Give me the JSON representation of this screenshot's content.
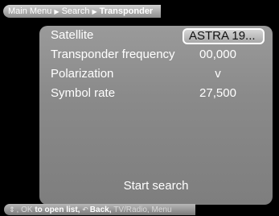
{
  "breadcrumb": {
    "items": [
      "Main Menu",
      "Search",
      "Transponder"
    ],
    "separator_icon": "triangle-right"
  },
  "settings": {
    "satellite": {
      "label": "Satellite",
      "value": "ASTRA 19..."
    },
    "frequency": {
      "label": "Transponder frequency",
      "value": "00,000"
    },
    "polarization": {
      "label": "Polarization",
      "value": "v"
    },
    "symbol_rate": {
      "label": "Symbol rate",
      "value": "27,500"
    }
  },
  "action": {
    "start_search_label": "Start search"
  },
  "hints": {
    "nav_icon": "up-down-arrows",
    "ok_label": "OK",
    "open_list_label": "to open list,",
    "back_icon": "back-arrow",
    "back_label": "Back,",
    "tvradio_label": "TV/Radio,",
    "menu_label": "Menu"
  },
  "colors": {
    "panel": "#8a8a8a",
    "background": "#000000",
    "text": "#ffffff"
  }
}
